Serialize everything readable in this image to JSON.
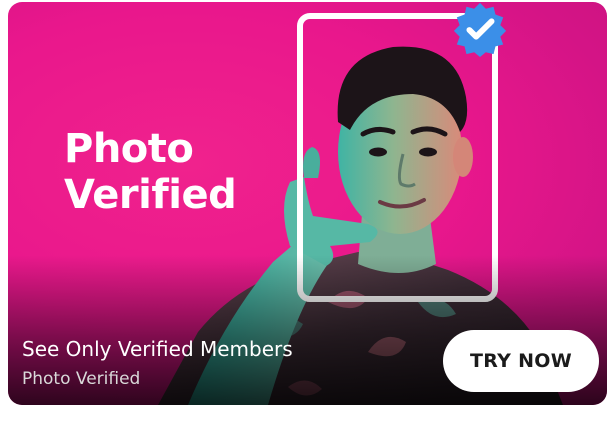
{
  "card": {
    "headline": "Photo Verified",
    "title": "See Only Verified Members",
    "subtitle": "Photo Verified",
    "cta_label": "TRY NOW"
  },
  "colors": {
    "background_pink": "#e9178c",
    "frame_white": "#ffffff",
    "badge_blue": "#3b8fe8",
    "button_bg": "#ffffff",
    "button_text": "#1b1b1b"
  },
  "icons": {
    "badge": "verified-check-badge-icon",
    "frame": "photo-frame"
  }
}
